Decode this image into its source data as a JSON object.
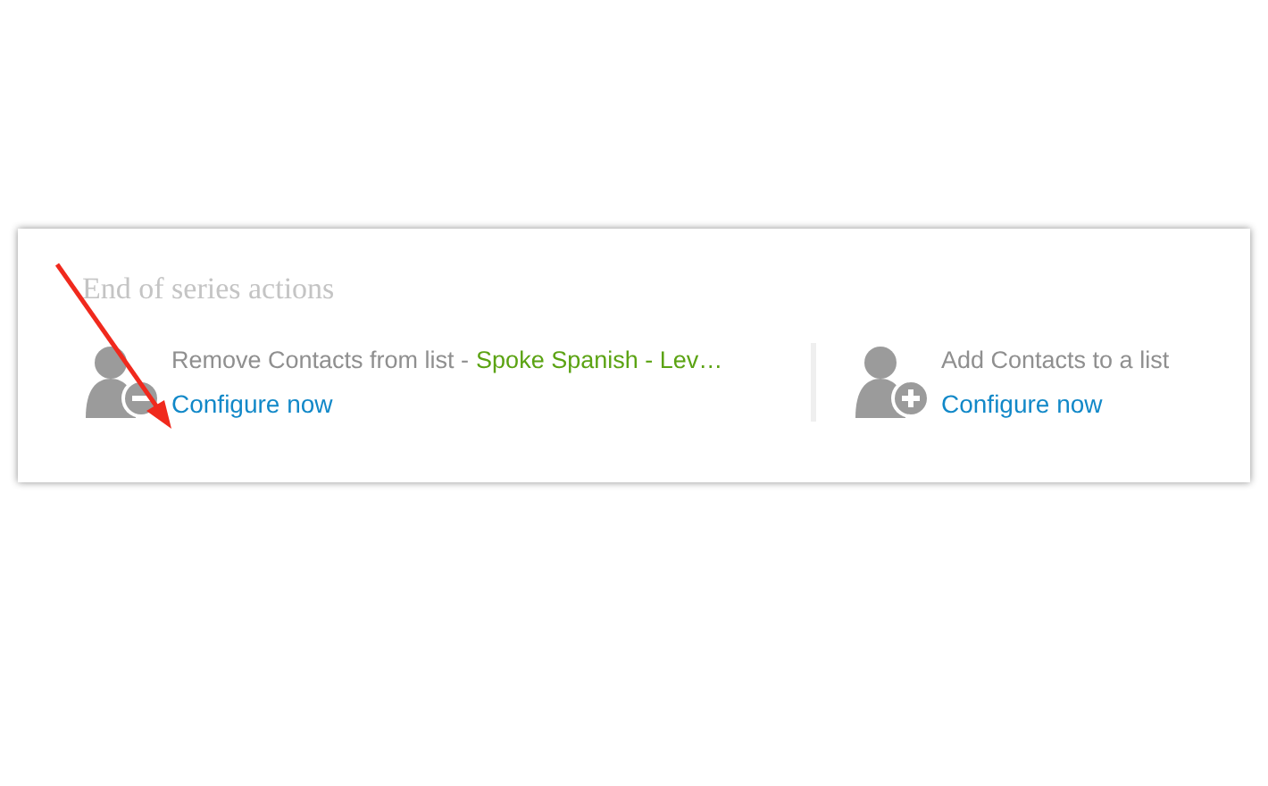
{
  "panel": {
    "title": "End of series actions",
    "actions": [
      {
        "kind": "remove",
        "label": "Remove Contacts from list -",
        "list_name": "Spoke Spanish - Lev…",
        "link": "Configure now"
      },
      {
        "kind": "add",
        "label": "Add Contacts to a list",
        "link": "Configure now"
      }
    ]
  },
  "annotation": {
    "kind": "arrow"
  }
}
